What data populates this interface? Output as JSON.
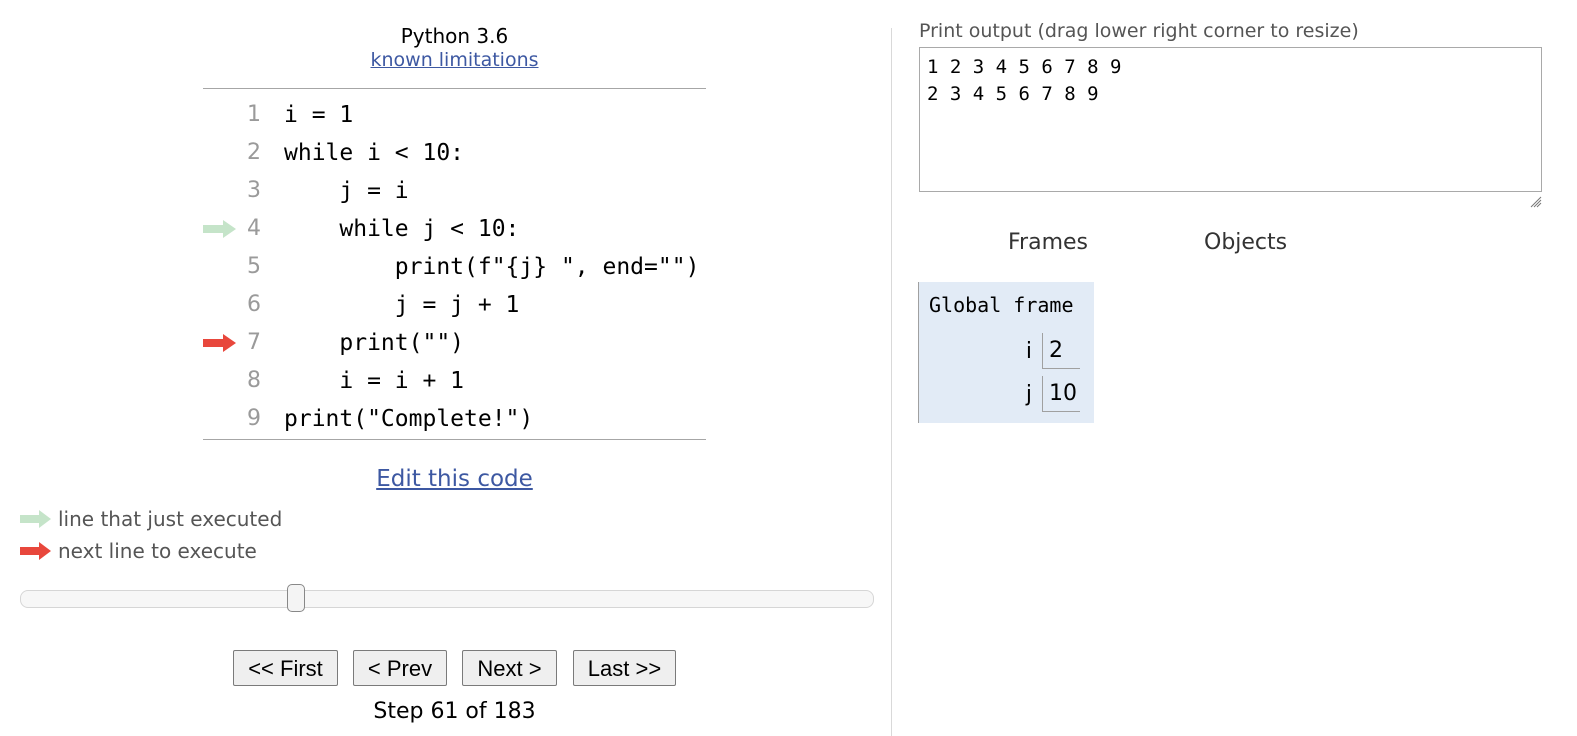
{
  "editor": {
    "language": "Python 3.6",
    "limitations_link": "known limitations",
    "lines": [
      {
        "num": "1",
        "code": "i = 1"
      },
      {
        "num": "2",
        "code": "while i < 10:"
      },
      {
        "num": "3",
        "code": "    j = i"
      },
      {
        "num": "4",
        "code": "    while j < 10:"
      },
      {
        "num": "5",
        "code": "        print(f\"{j} \", end=\"\")"
      },
      {
        "num": "6",
        "code": "        j = j + 1"
      },
      {
        "num": "7",
        "code": "    print(\"\")"
      },
      {
        "num": "8",
        "code": "    i = i + 1"
      },
      {
        "num": "9",
        "code": "print(\"Complete!\")"
      }
    ],
    "just_executed_line": 4,
    "next_line": 7,
    "edit_link": "Edit this code"
  },
  "legend": {
    "just_executed": "line that just executed",
    "next_to_execute": "next line to execute"
  },
  "colors": {
    "just_executed_arrow": "#c5e4c9",
    "next_arrow": "#e8473c",
    "frame_background": "#e2ebf6",
    "link": "#3d58a2"
  },
  "navigation": {
    "first": "<< First",
    "prev": "< Prev",
    "next": "Next >",
    "last": "Last >>",
    "step_text": "Step 61 of 183",
    "current_step": 61,
    "total_steps": 183
  },
  "output": {
    "label": "Print output (drag lower right corner to resize)",
    "text": "1 2 3 4 5 6 7 8 9\n2 3 4 5 6 7 8 9"
  },
  "visualizer": {
    "frames_heading": "Frames",
    "objects_heading": "Objects",
    "frame_title": "Global frame",
    "variables": [
      {
        "name": "i",
        "value": "2"
      },
      {
        "name": "j",
        "value": "10"
      }
    ]
  }
}
